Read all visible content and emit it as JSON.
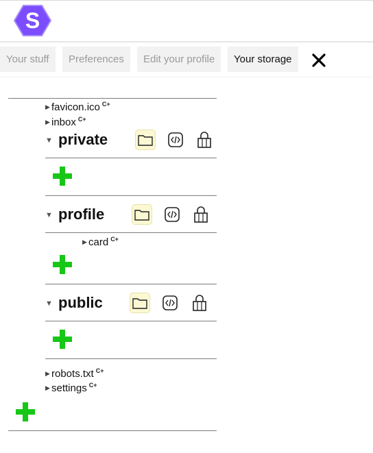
{
  "app": {
    "logo_letter": "S",
    "brand_color": "#8b5cf6"
  },
  "tabs": [
    {
      "label": "Your stuff",
      "active": false
    },
    {
      "label": "Preferences",
      "active": false
    },
    {
      "label": "Edit your profile",
      "active": false
    },
    {
      "label": "Your storage",
      "active": true
    }
  ],
  "close_icon": "close-x-icon",
  "storage": {
    "tag": "C+",
    "root_files": [
      "favicon.ico",
      "inbox"
    ],
    "folders": [
      {
        "name": "private",
        "children": []
      },
      {
        "name": "profile",
        "children": [
          "card"
        ]
      },
      {
        "name": "public",
        "children": []
      }
    ],
    "bottom_files": [
      "robots.txt",
      "settings"
    ],
    "folder_icons": [
      "folder-icon",
      "code-icon",
      "lock-icon"
    ],
    "add_icon": "plus-icon",
    "add_color": "#17c717"
  }
}
